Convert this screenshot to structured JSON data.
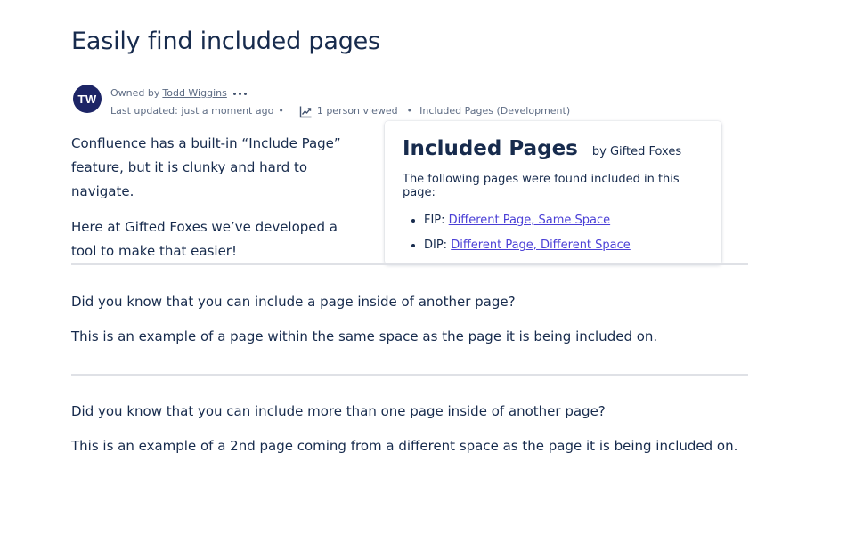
{
  "page": {
    "title": "Easily find included pages"
  },
  "byline": {
    "avatar_initials": "TW",
    "owned_by_prefix": "Owned by",
    "owner_name": "Todd Wiggins",
    "last_updated": "Last updated: just a moment ago",
    "views": "1 person viewed",
    "space_name": "Included Pages (Development)",
    "separator": "•",
    "icons": {
      "more": "more-horizontal-icon",
      "analytics": "chart-line-icon"
    }
  },
  "intro": {
    "paragraph1": "Confluence has a built-in “Include Page” feature, but it is clunky and hard to navigate.",
    "paragraph2": "Here at Gifted Foxes we’ve developed a tool to make that easier!"
  },
  "panel": {
    "title": "Included Pages",
    "by": "by Gifted Foxes",
    "description": "The following pages were found included in this page:",
    "items": [
      {
        "prefix": "FIP:",
        "link": "Different Page, Same Space"
      },
      {
        "prefix": "DIP:",
        "link": "Different Page, Different Space"
      }
    ]
  },
  "sections": [
    {
      "question": "Did you know that you can include a page inside of another page?",
      "example": "This is an example of a page within the same space as the page it is being included on."
    },
    {
      "question": "Did you know that you can include more than one page inside of another page?",
      "example": "This is an example of a 2nd page coming from a different space as the page it is being included on."
    }
  ],
  "colors": {
    "text": "#172b4d",
    "muted": "#5e6c84",
    "avatar_bg": "#1d2566",
    "link": "#4a3fd6",
    "divider": "#dfe1e6"
  }
}
